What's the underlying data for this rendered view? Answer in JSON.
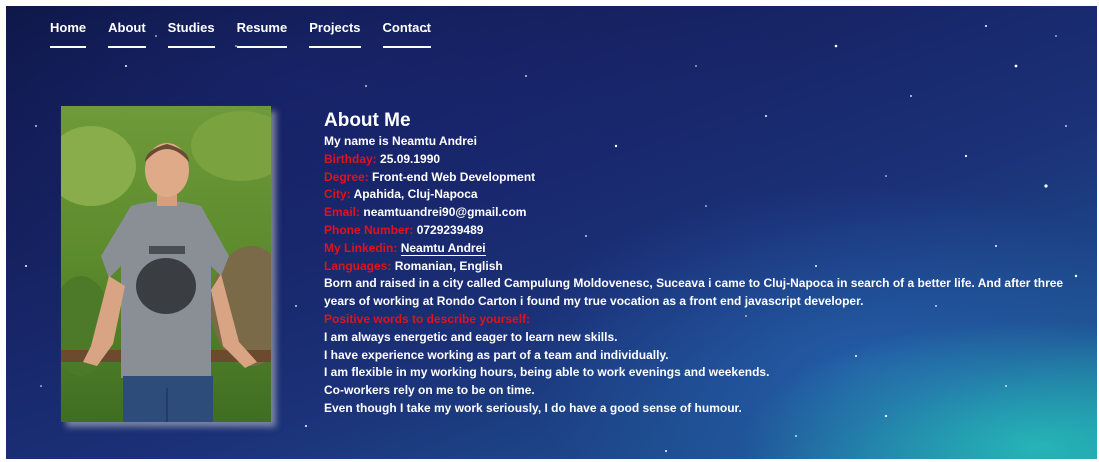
{
  "nav": {
    "items": [
      "Home",
      "About",
      "Studies",
      "Resume",
      "Projects",
      "Contact"
    ]
  },
  "about": {
    "title": "About Me",
    "intro": "My name is Neamtu Andrei",
    "fields": {
      "birthday": {
        "label": "Birthday:",
        "value": "25.09.1990"
      },
      "degree": {
        "label": "Degree:",
        "value": "Front-end Web Development"
      },
      "city": {
        "label": "City:",
        "value": "Apahida, Cluj-Napoca"
      },
      "email": {
        "label": "Email:",
        "value": "neamtuandrei90@gmail.com"
      },
      "phone": {
        "label": "Phone Number:",
        "value": "0729239489"
      },
      "linkedin": {
        "label": "My Linkedin:",
        "value": "Neamtu Andrei"
      },
      "languages": {
        "label": "Languages:",
        "value": "Romanian, English"
      }
    },
    "bio": "Born and raised in a city called Campulung Moldovenesc, Suceava i came to Cluj-Napoca in search of a better life. And after three years of working at Rondo Carton i found my true vocation as a front end javascript developer.",
    "positive_heading": "Positive words to describe yourself:",
    "positive_list": [
      "I am always energetic and eager to learn new skills.",
      "I have experience working as part of a team and individually.",
      "I am flexible in my working hours, being able to work evenings and weekends.",
      "Co-workers rely on me to be on time.",
      "Even though I take my work seriously, I do have a good sense of humour."
    ]
  },
  "colors": {
    "label_red": "#e0121c",
    "text_white": "#ffffff",
    "sky_dark": "#0c1540",
    "sky_teal": "#1c8a9e"
  }
}
